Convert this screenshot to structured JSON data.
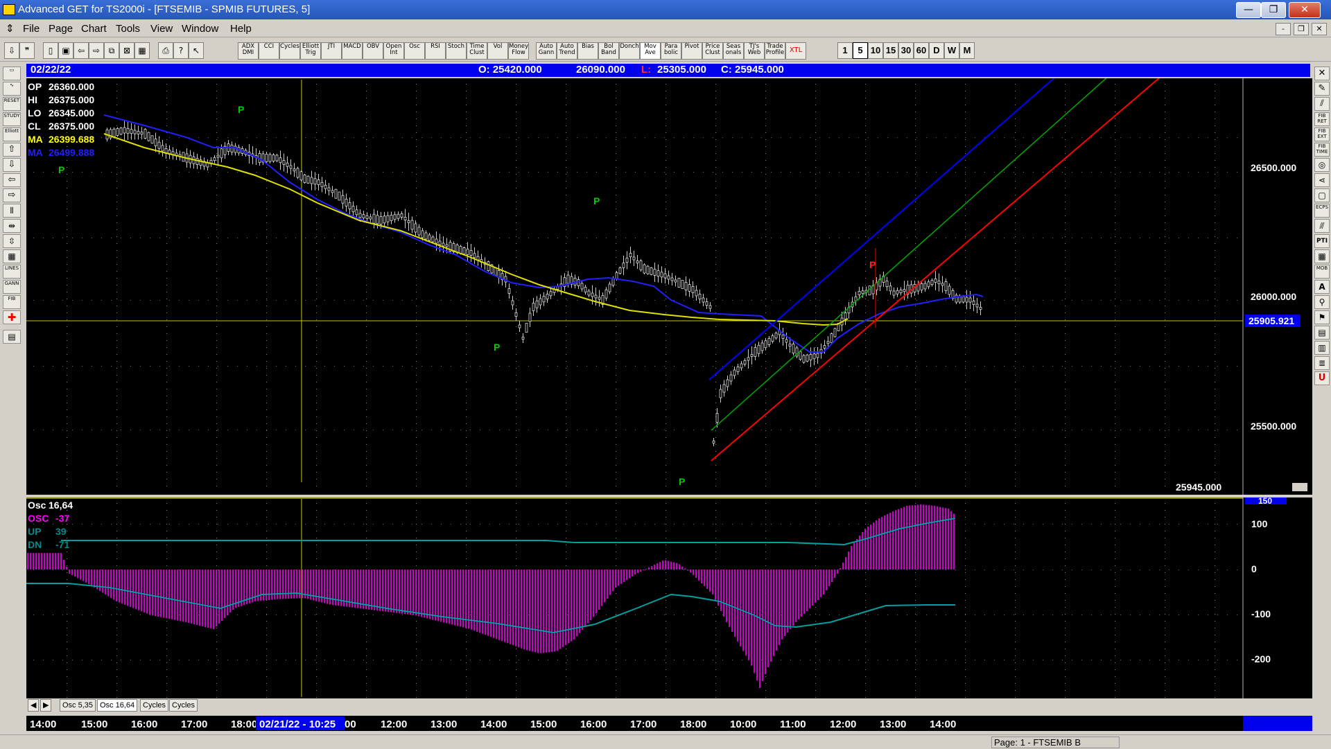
{
  "window": {
    "title": "Advanced GET for TS2000i - [FTSEMIB - SPMIB FUTURES, 5]",
    "controls": {
      "minimize": "—",
      "maximize": "❐",
      "close": "✕"
    }
  },
  "menu": {
    "items": [
      "File",
      "Page",
      "Chart",
      "Tools",
      "View",
      "Window",
      "Help"
    ],
    "mdi": {
      "minimize": "-",
      "restore": "❐",
      "close": "✕"
    }
  },
  "toolbar": {
    "icons": [
      "pin-icon",
      "quote-icon",
      "new-icon",
      "open-icon",
      "back-icon",
      "forward-icon",
      "copy-icon",
      "delete-icon",
      "tile-icon",
      "print-icon",
      "help-icon",
      "what-icon"
    ],
    "indicators": [
      "ADX DMI",
      "CCI",
      "Cycles",
      "Elliott Trig",
      "JTI",
      "MACD",
      "OBV",
      "Open Int",
      "Osc",
      "RSI",
      "Stoch",
      "Time Clust",
      "Vol",
      "Money Flow",
      "Auto Gann",
      "Auto Trend",
      "Bias",
      "Bol Band",
      "Donch",
      "Mov Ave",
      "Para bolic",
      "Pivot",
      "Price Clust",
      "Seas onals",
      "TJ's Web",
      "Trade Profile",
      "XTL"
    ],
    "timeframes": [
      "1",
      "5",
      "10",
      "15",
      "30",
      "60",
      "D",
      "W",
      "M"
    ],
    "selected_timeframe": "5"
  },
  "leftbar": {
    "buttons": [
      "open-icon",
      "wave-icon",
      "reset-icon",
      "study-icon",
      "elliott-icon",
      "up-arrow-icon",
      "down-arrow-icon",
      "left-arrow-icon",
      "right-arrow-icon",
      "bars-icon",
      "expand-icon",
      "compress-icon",
      "grid-icon",
      "lines-icon",
      "gann-icon",
      "fib-icon",
      "crosshair-icon",
      "save-icon"
    ],
    "labels": {
      "reset": "RESET",
      "study": "STUDY",
      "elliott": "Elliott",
      "lines": "LINES",
      "gann": "GANN",
      "fib": "FIB"
    }
  },
  "rightbar": {
    "labels": [
      "FIB RET",
      "FIB EXT",
      "FIB TIME",
      "ECPS",
      "PTI",
      "MOB",
      "A",
      "U"
    ]
  },
  "header": {
    "date": "02/22/22",
    "open": "O: 25420.000",
    "high": "26090.000",
    "low_label": "L:",
    "low": "25305.000",
    "close": "C: 25945.000"
  },
  "price_panel": {
    "readouts": [
      {
        "label": "OP",
        "value": "26360.000",
        "color": "#ffffff"
      },
      {
        "label": "HI",
        "value": "26375.000",
        "color": "#ffffff"
      },
      {
        "label": "LO",
        "value": "26345.000",
        "color": "#ffffff"
      },
      {
        "label": "CL",
        "value": "26375.000",
        "color": "#ffffff"
      },
      {
        "label": "MA",
        "value": "26399.688",
        "color": "#ffff00"
      },
      {
        "label": "MA",
        "value": "26499.888",
        "color": "#2020ff"
      }
    ],
    "scale_labels": [
      "26500.000",
      "26000.000",
      "25500.000"
    ],
    "current_price": "25905.921",
    "last_close": "25945.000",
    "pivot_label": "P"
  },
  "osc_panel": {
    "readouts": [
      {
        "label": "Osc",
        "value": "16,64",
        "color": "#ffffff"
      },
      {
        "label": "OSC",
        "value": "-37",
        "color": "#ff00ff"
      },
      {
        "label": "UP",
        "value": "39",
        "color": "#008b8b"
      },
      {
        "label": "DN",
        "value": "-71",
        "color": "#008b8b"
      }
    ],
    "scale_labels": [
      "150",
      "100",
      "0",
      "-100",
      "-200"
    ]
  },
  "tabs": [
    "Osc 5,35",
    "Osc 16,64",
    "Cycles",
    "Cycles"
  ],
  "selected_tab": "Osc 16,64",
  "time_axis": {
    "labels": [
      "14:00",
      "15:00",
      "16:00",
      "17:00",
      "18:00",
      "02/21/22 - 10:25",
      "00",
      "12:00",
      "13:00",
      "14:00",
      "15:00",
      "16:00",
      "17:00",
      "18:00",
      "10:00",
      "11:00",
      "12:00",
      "13:00",
      "14:00"
    ]
  },
  "status": {
    "page": "Page: 1 - FTSEMIB B"
  },
  "colors": {
    "accent": "#0000ee",
    "price_up": "#ffffff",
    "ma_fast": "#ffff00",
    "ma_slow": "#2020ff",
    "channel_top": "#0000ff",
    "channel_mid": "#00aa00",
    "channel_bot": "#ff0000",
    "osc_hist": "#ff00ff",
    "osc_band": "#008b8b"
  }
}
